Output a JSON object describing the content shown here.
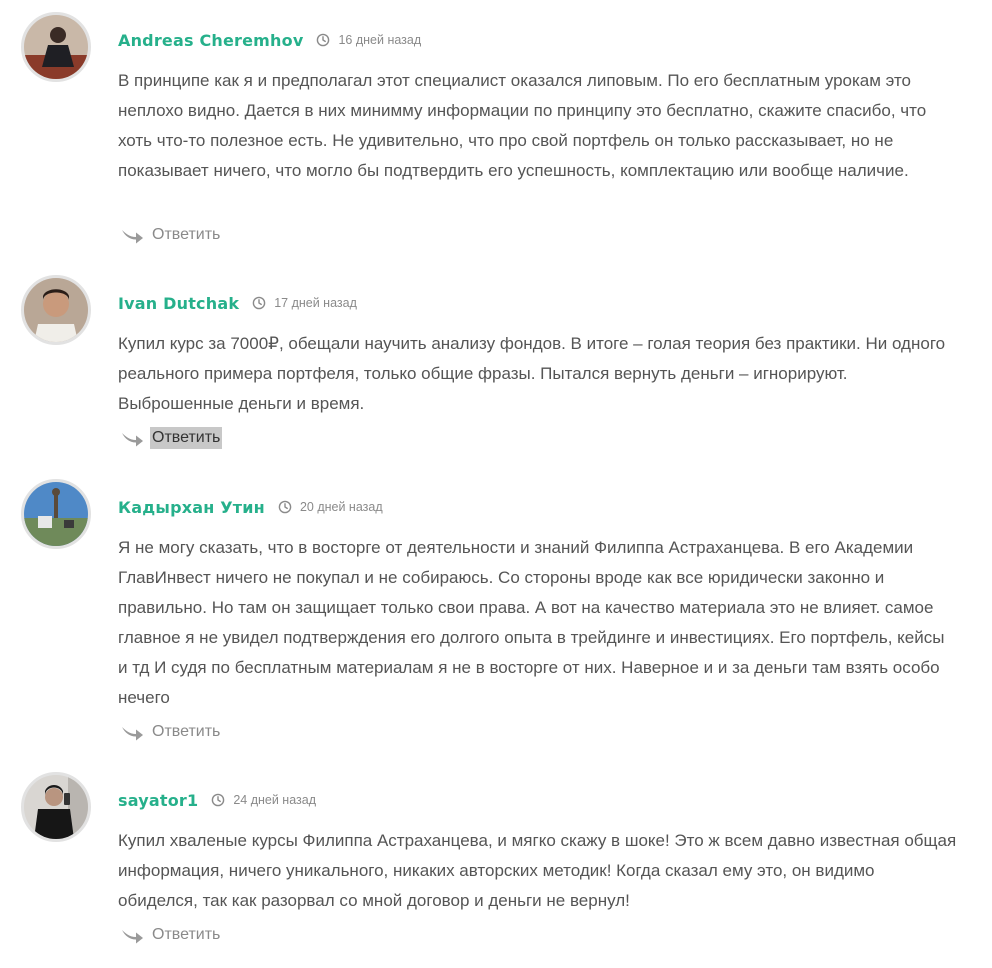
{
  "comments": [
    {
      "author": "Andreas Cheremhov",
      "date": "16 дней назад",
      "text": "В принципе как я и предполагал этот специалист оказался липовым. По его бесплатным урокам это неплохо видно. Дается в них минимму информации по принципу это бесплатно, скажите спасибо, что хоть что-то полезное есть. Не удивительно, что про свой портфель он только рассказывает, но не показывает ничего, что могло бы подтвердить его успешность, комплектацию или вообще наличие.",
      "reply_label": "Ответить"
    },
    {
      "author": "Ivan Dutchak",
      "date": "17 дней назад",
      "text": "Купил курс за 7000₽, обещали научить анализу фондов. В итоге – голая теория без практики. Ни одного реального примера портфеля, только общие фразы. Пытался вернуть деньги – игнорируют. Выброшенные деньги и время.",
      "reply_label": "Ответить"
    },
    {
      "author": "Кадырхан Утин",
      "date": "20 дней назад",
      "text": "Я не могу сказать, что в восторге от деятельности и знаний Филиппа Астраханцева. В его Академии ГлавИнвест ничего не покупал и не собираюсь. Со стороны вроде как все юридически законно и правильно. Но там он защищает только свои права. А вот на качество материала это не влияет. самое главное я не увидел подтверждения его долгого опыта в трейдинге и инвестициях. Его портфель, кейсы и тд И судя по бесплатным материалам я не в восторге от них. Наверное и и за деньги там взять особо нечего",
      "reply_label": "Ответить"
    },
    {
      "author": "sayator1",
      "date": "24 дней назад",
      "text": "Купил хваленые курсы Филиппа Астраханцева, и мягко скажу в шоке! Это ж всем давно известная общая информация, ничего уникального, никаких авторских методик! Когда сказал ему это, он видимо обиделся, так как разорвал со мной договор и деньги не вернул!",
      "reply_label": "Ответить"
    }
  ],
  "colors": {
    "author": "#26b08b",
    "text": "#555555",
    "muted": "#8a8a8a",
    "highlight": "#c8c8c8"
  },
  "icons": {
    "clock": "clock-icon",
    "reply": "reply-arrow-icon"
  }
}
